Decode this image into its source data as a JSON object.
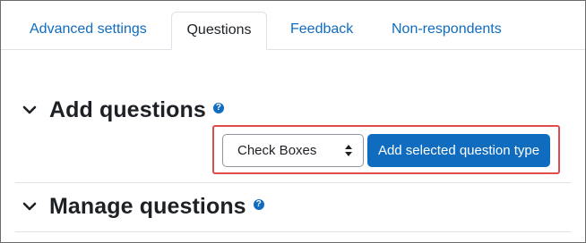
{
  "tabs": [
    {
      "label": "Advanced settings",
      "active": false
    },
    {
      "label": "Questions",
      "active": true
    },
    {
      "label": "Feedback",
      "active": false
    },
    {
      "label": "Non-respondents",
      "active": false
    }
  ],
  "add_section": {
    "title": "Add questions",
    "help_icon": "question-circle-icon",
    "select_value": "Check Boxes",
    "button_label": "Add selected question type"
  },
  "manage_section": {
    "title": "Manage questions",
    "help_icon": "question-circle-icon"
  },
  "colors": {
    "link": "#0f6cbf",
    "primary_button": "#0f6cbf",
    "highlight_border": "#e04b4b",
    "text": "#1d2125"
  }
}
